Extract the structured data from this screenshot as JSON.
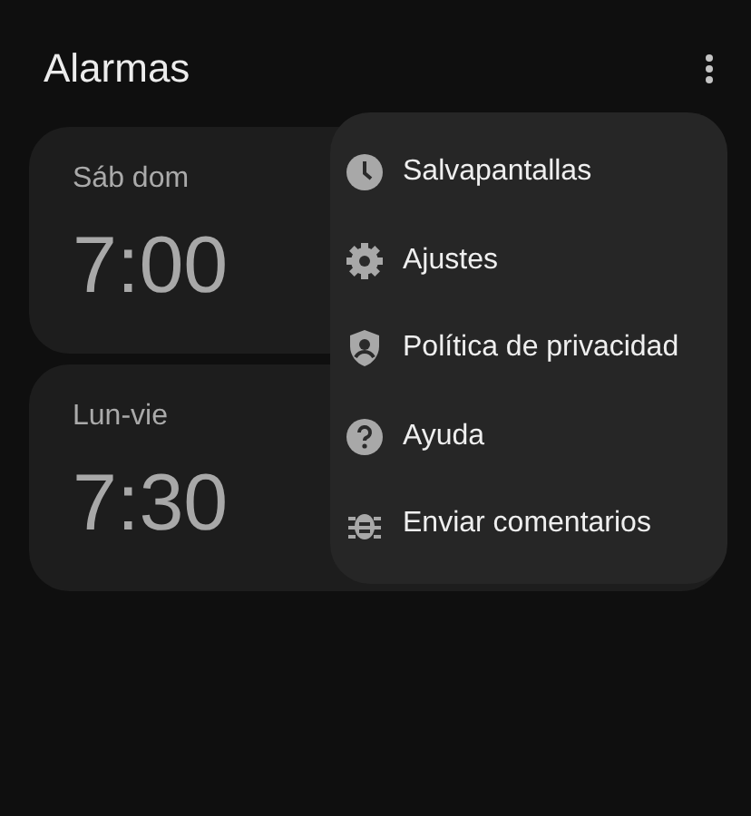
{
  "header": {
    "title": "Alarmas"
  },
  "alarms": [
    {
      "days": "Sáb dom",
      "time": "7:00"
    },
    {
      "days": "Lun-vie",
      "time": "7:30"
    }
  ],
  "menu": {
    "items": [
      {
        "kind": "clock",
        "label": "Salvapantallas"
      },
      {
        "kind": "gear",
        "label": "Ajustes"
      },
      {
        "kind": "shield",
        "label": "Política de privacidad"
      },
      {
        "kind": "help",
        "label": "Ayuda"
      },
      {
        "kind": "bug",
        "label": "Enviar comentarios"
      }
    ]
  }
}
